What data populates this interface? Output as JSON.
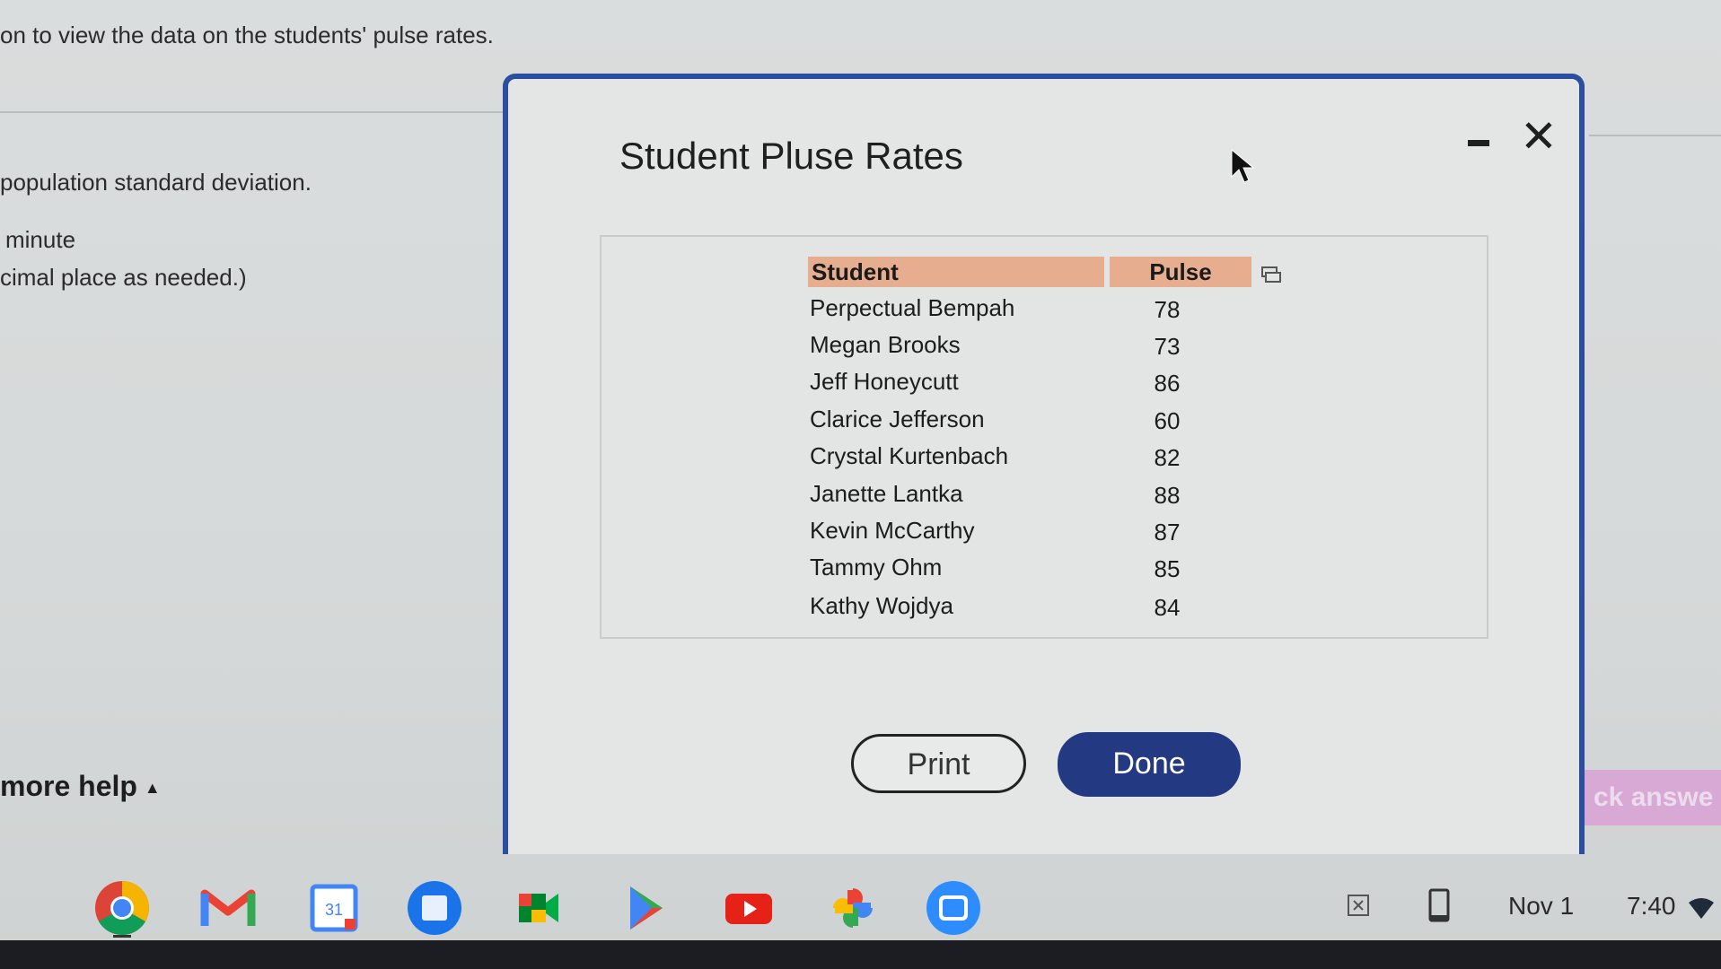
{
  "background": {
    "instruction_fragment": "on to view the data on the students' pulse rates.",
    "question_fragment": "population standard deviation.",
    "unit_fragment": "minute",
    "rounding_fragment": "cimal place as needed.)",
    "more_help": "more help",
    "check_answer_fragment": "ck answe"
  },
  "dialog": {
    "title": "Student Pluse Rates",
    "columns": [
      "Student",
      "Pulse"
    ],
    "rows": [
      {
        "name": "Perpectual Bempah",
        "pulse": "78"
      },
      {
        "name": "Megan Brooks",
        "pulse": "73"
      },
      {
        "name": "Jeff Honeycutt",
        "pulse": "86"
      },
      {
        "name": "Clarice Jefferson",
        "pulse": "60"
      },
      {
        "name": "Crystal Kurtenbach",
        "pulse": "82"
      },
      {
        "name": "Janette Lantka",
        "pulse": "88"
      },
      {
        "name": "Kevin McCarthy",
        "pulse": "87"
      },
      {
        "name": "Tammy Ohm",
        "pulse": "85"
      },
      {
        "name": "Kathy Wojdya",
        "pulse": "84"
      }
    ],
    "print_label": "Print",
    "done_label": "Done"
  },
  "taskbar": {
    "apps": [
      "chrome-icon",
      "gmail-icon",
      "calendar-icon",
      "files-icon",
      "meet-icon",
      "play-store-icon",
      "youtube-icon",
      "photos-icon",
      "zoom-icon"
    ],
    "calendar_date": "31",
    "date": "Nov 1",
    "time": "7:40"
  },
  "colors": {
    "dialog_border": "#2a4fa0",
    "header_fill": "#e7ad8f",
    "done_button": "#233a82",
    "check_answer": "#d7a9d4"
  }
}
